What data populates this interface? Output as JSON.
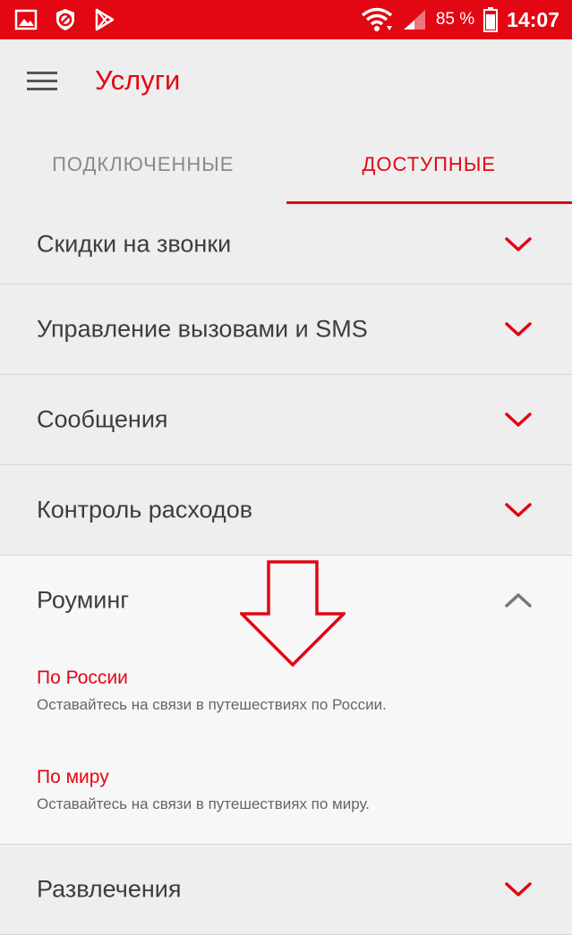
{
  "statusbar": {
    "battery": "85 %",
    "time": "14:07",
    "icons": [
      "gallery-icon",
      "block-icon",
      "play-store-icon",
      "wifi-icon",
      "signal-icon",
      "battery-icon"
    ]
  },
  "appbar": {
    "title": "Услуги",
    "menu_icon": "hamburger-menu-icon"
  },
  "tabs": [
    {
      "label": "ПОДКЛЮЧЕННЫЕ",
      "active": false
    },
    {
      "label": "ДОСТУПНЫЕ",
      "active": true
    }
  ],
  "categories": [
    {
      "label": "Скидки на звонки",
      "expanded": false
    },
    {
      "label": "Управление вызовами и SMS",
      "expanded": false
    },
    {
      "label": "Сообщения",
      "expanded": false
    },
    {
      "label": "Контроль расходов",
      "expanded": false
    },
    {
      "label": "Роуминг",
      "expanded": true
    },
    {
      "label": "Развлечения",
      "expanded": false
    }
  ],
  "roaming_items": [
    {
      "title": "По России",
      "description": "Оставайтесь на связи в путешествиях по России."
    },
    {
      "title": "По миру",
      "description": "Оставайтесь на связи в путешествиях по миру."
    }
  ],
  "colors": {
    "accent": "#e30613",
    "background": "#eeeeee",
    "expanded_background": "#f7f7f7",
    "text": "#3d3d3d"
  }
}
